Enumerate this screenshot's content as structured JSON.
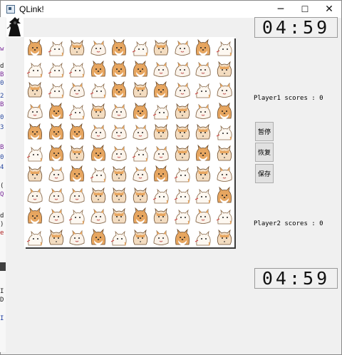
{
  "window": {
    "title": "QLink!",
    "minimize_glyph": "─",
    "maximize_glyph": "☐",
    "close_glyph": "✕"
  },
  "game": {
    "player1_timer": "04:59",
    "player2_timer": "04:59",
    "player1_score_text": "Player1 scores : 0",
    "player2_score_text": "Player2 scores : 0",
    "buttons": {
      "pause": "暂停",
      "resume": "恢复",
      "save": "保存"
    },
    "board": {
      "rows": 10,
      "cols": 10,
      "tile_icon": "shiba-dog-icon"
    }
  },
  "background_window": {
    "left_strip_chars": [
      "w",
      "d",
      "B",
      "0",
      "2",
      "B",
      "0",
      "3",
      "B",
      "0",
      "4",
      "(",
      "Q",
      "d",
      ")",
      "e"
    ],
    "lower_strip_chars": [
      "I",
      "D",
      "I"
    ]
  }
}
